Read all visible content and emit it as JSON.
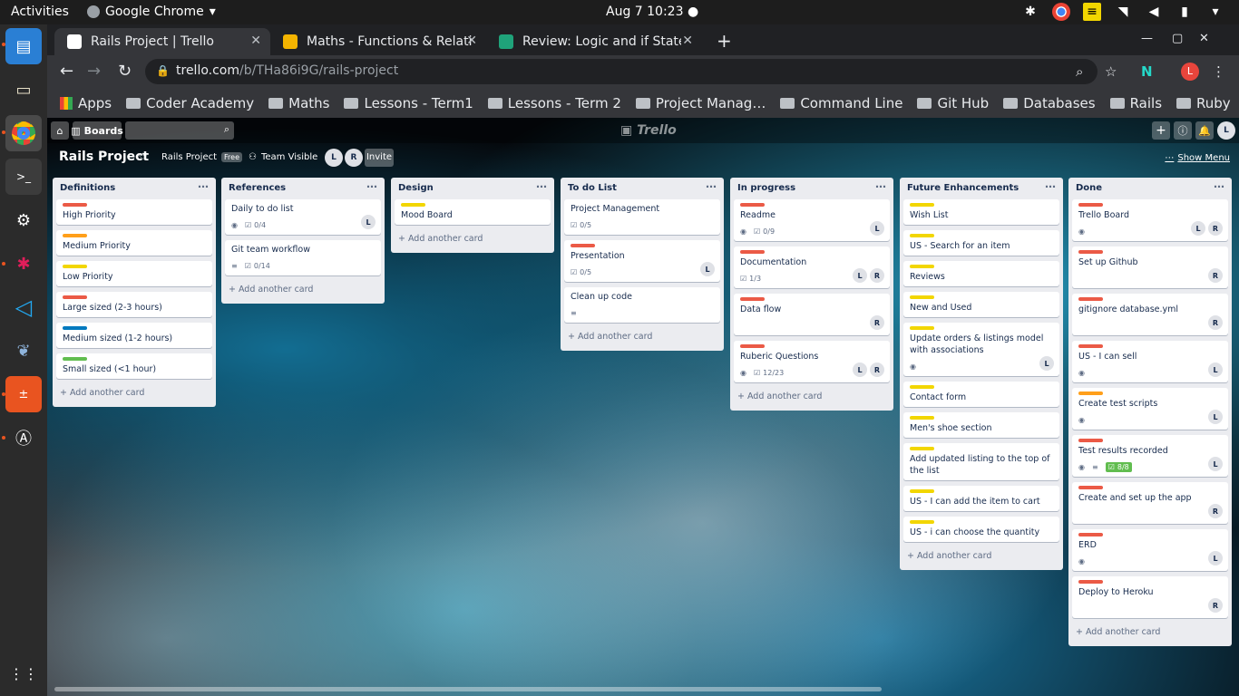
{
  "os": {
    "activities": "Activities",
    "app_name": "Google Chrome",
    "clock": "Aug 7  10:23 ●"
  },
  "browser": {
    "tabs": [
      {
        "title": "Rails Project | Trello",
        "active": true
      },
      {
        "title": "Maths - Functions & Relati",
        "active": false
      },
      {
        "title": "Review: Logic and if State",
        "active": false
      }
    ],
    "url_host": "trello.com",
    "url_path": "/b/THa86i9G/rails-project",
    "profile_initial": "L",
    "bookmarks": [
      "Apps",
      "Coder Academy",
      "Maths",
      "Lessons - Term1",
      "Lessons - Term 2",
      "Project Manag…",
      "Command Line",
      "Git Hub",
      "Databases",
      "Rails",
      "Ruby"
    ]
  },
  "trello": {
    "boards_label": "Boards",
    "logo": "Trello",
    "user_initial": "L",
    "board_title": "Rails Project",
    "workspace": "Rails Project",
    "free": "Free",
    "visibility": "Team Visible",
    "members": [
      "L",
      "R"
    ],
    "invite": "Invite",
    "show_menu": "Show Menu",
    "add_card": "+ Add another card",
    "lists": [
      {
        "title": "Definitions",
        "cards": [
          {
            "title": "High Priority",
            "labels": [
              "#eb5a46"
            ]
          },
          {
            "title": "Medium Priority",
            "labels": [
              "#ff9f1a"
            ]
          },
          {
            "title": "Low Priority",
            "labels": [
              "#f2d600"
            ]
          },
          {
            "title": "Large sized (2-3 hours)",
            "labels": [
              "#eb5a46"
            ]
          },
          {
            "title": "Medium sized (1-2 hours)",
            "labels": [
              "#0079bf"
            ]
          },
          {
            "title": "Small sized (<1 hour)",
            "labels": [
              "#61bd4f"
            ]
          }
        ]
      },
      {
        "title": "References",
        "cards": [
          {
            "title": "Daily to do list",
            "labels": [],
            "watch": true,
            "checklist": "0/4",
            "members": [
              "L"
            ]
          },
          {
            "title": "Git team workflow",
            "labels": [],
            "desc": true,
            "checklist": "0/14"
          }
        ]
      },
      {
        "title": "Design",
        "cards": [
          {
            "title": "Mood Board",
            "labels": [
              "#f2d600"
            ]
          }
        ]
      },
      {
        "title": "To do List",
        "cards": [
          {
            "title": "Project Management",
            "labels": [],
            "checklist": "0/5"
          },
          {
            "title": "Presentation",
            "labels": [
              "#eb5a46"
            ],
            "checklist": "0/5",
            "members": [
              "L"
            ]
          },
          {
            "title": "Clean up code",
            "labels": [],
            "desc": true
          }
        ]
      },
      {
        "title": "In progress",
        "cards": [
          {
            "title": "Readme",
            "labels": [
              "#eb5a46"
            ],
            "watch": true,
            "checklist": "0/9",
            "members": [
              "L"
            ]
          },
          {
            "title": "Documentation",
            "labels": [
              "#eb5a46"
            ],
            "checklist": "1/3",
            "members": [
              "L",
              "R"
            ]
          },
          {
            "title": "Data flow",
            "labels": [
              "#eb5a46"
            ],
            "members": [
              "R"
            ]
          },
          {
            "title": "Ruberic Questions",
            "labels": [
              "#eb5a46"
            ],
            "watch": true,
            "checklist": "12/23",
            "members": [
              "L",
              "R"
            ]
          }
        ]
      },
      {
        "title": "Future Enhancements",
        "cards": [
          {
            "title": "Wish List",
            "labels": [
              "#f2d600"
            ]
          },
          {
            "title": "US - Search for an item",
            "labels": [
              "#f2d600"
            ]
          },
          {
            "title": "Reviews",
            "labels": [
              "#f2d600"
            ]
          },
          {
            "title": "New and Used",
            "labels": [
              "#f2d600"
            ]
          },
          {
            "title": "Update orders & listings model with associations",
            "labels": [
              "#f2d600"
            ],
            "watch": true,
            "members": [
              "L"
            ]
          },
          {
            "title": "Contact form",
            "labels": [
              "#f2d600"
            ]
          },
          {
            "title": "Men's shoe section",
            "labels": [
              "#f2d600"
            ]
          },
          {
            "title": "Add updated listing to the top of the list",
            "labels": [
              "#f2d600"
            ]
          },
          {
            "title": "US - I can add the item to cart",
            "labels": [
              "#f2d600"
            ]
          },
          {
            "title": "US - i can choose the quantity",
            "labels": [
              "#f2d600"
            ]
          }
        ]
      },
      {
        "title": "Done",
        "cards": [
          {
            "title": "Trello Board",
            "labels": [
              "#eb5a46"
            ],
            "watch": true,
            "members": [
              "L",
              "R"
            ]
          },
          {
            "title": "Set up Github",
            "labels": [
              "#eb5a46"
            ],
            "members": [
              "R"
            ]
          },
          {
            "title": "gitignore database.yml",
            "labels": [
              "#eb5a46"
            ],
            "members": [
              "R"
            ]
          },
          {
            "title": "US - I can sell",
            "labels": [
              "#eb5a46"
            ],
            "watch": true,
            "members": [
              "L"
            ]
          },
          {
            "title": "Create test scripts",
            "labels": [
              "#ff9f1a"
            ],
            "watch": true,
            "members": [
              "L"
            ]
          },
          {
            "title": "Test results recorded",
            "labels": [
              "#eb5a46"
            ],
            "watch": true,
            "desc": true,
            "checklist_done": "8/8",
            "members": [
              "L"
            ]
          },
          {
            "title": "Create and set up the app",
            "labels": [
              "#eb5a46"
            ],
            "members": [
              "R"
            ]
          },
          {
            "title": "ERD",
            "labels": [
              "#eb5a46"
            ],
            "watch": true,
            "members": [
              "L"
            ]
          },
          {
            "title": "Deploy to Heroku",
            "labels": [
              "#eb5a46"
            ],
            "members": [
              "R"
            ]
          }
        ]
      }
    ]
  }
}
